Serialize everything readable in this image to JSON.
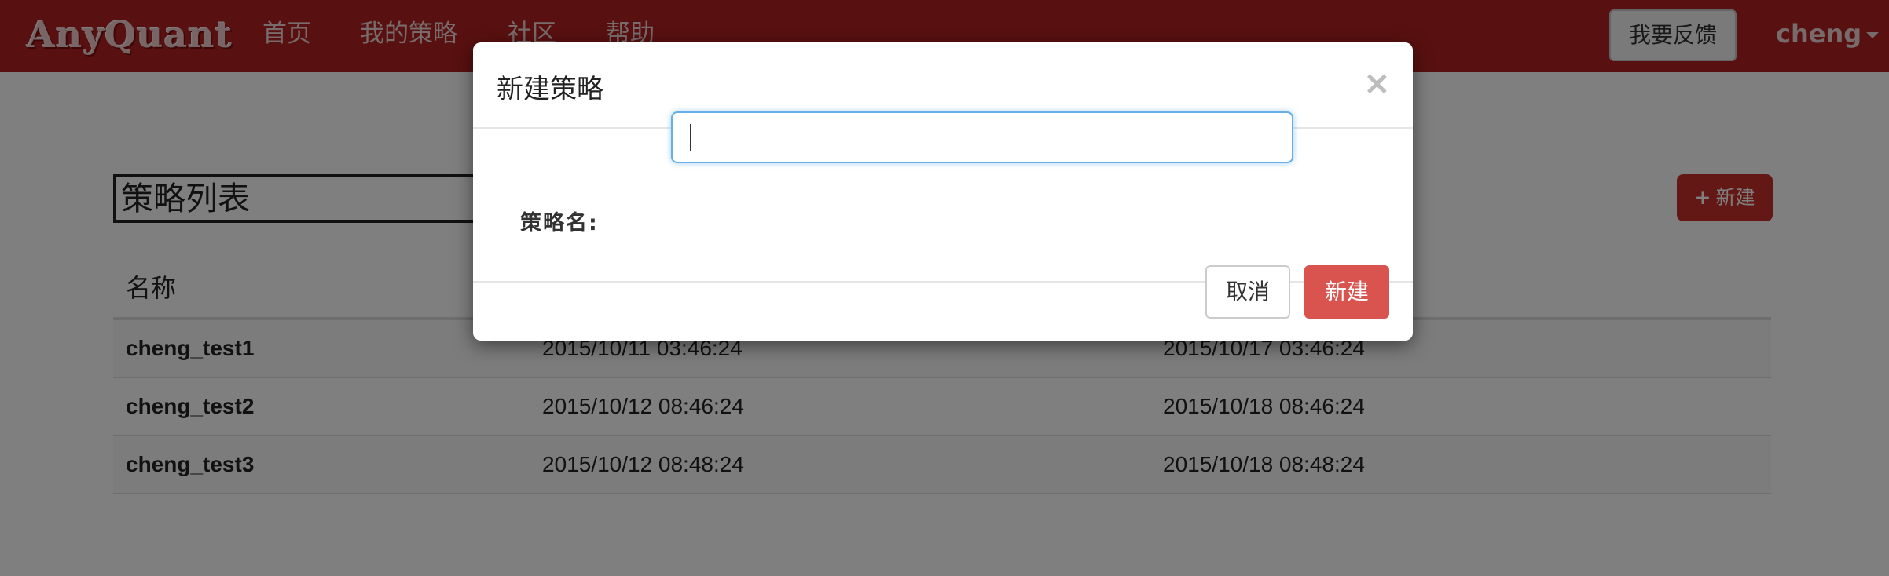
{
  "navbar": {
    "brand": "AnyQuant",
    "links": [
      "首页",
      "我的策略",
      "社区",
      "帮助"
    ],
    "feedback_label": "我要反馈",
    "user": "cheng"
  },
  "page": {
    "title": "策略列表",
    "new_button_label": "新建",
    "new_button_icon": "plus-icon",
    "table": {
      "header_name": "名称",
      "rows": [
        [
          "cheng_test1",
          "2015/10/11 03:46:24",
          "2015/10/17 03:46:24"
        ],
        [
          "cheng_test2",
          "2015/10/12 08:46:24",
          "2015/10/18 08:46:24"
        ],
        [
          "cheng_test3",
          "2015/10/12 08:48:24",
          "2015/10/18 08:48:24"
        ]
      ]
    }
  },
  "modal": {
    "title": "新建策略",
    "close_symbol": "×",
    "field_label": "策略名:",
    "field_value": "",
    "cancel_label": "取消",
    "create_label": "新建"
  },
  "colors": {
    "navbar": "#b32121",
    "primary_button": "#d9534f",
    "focus_border": "#66afe9"
  }
}
